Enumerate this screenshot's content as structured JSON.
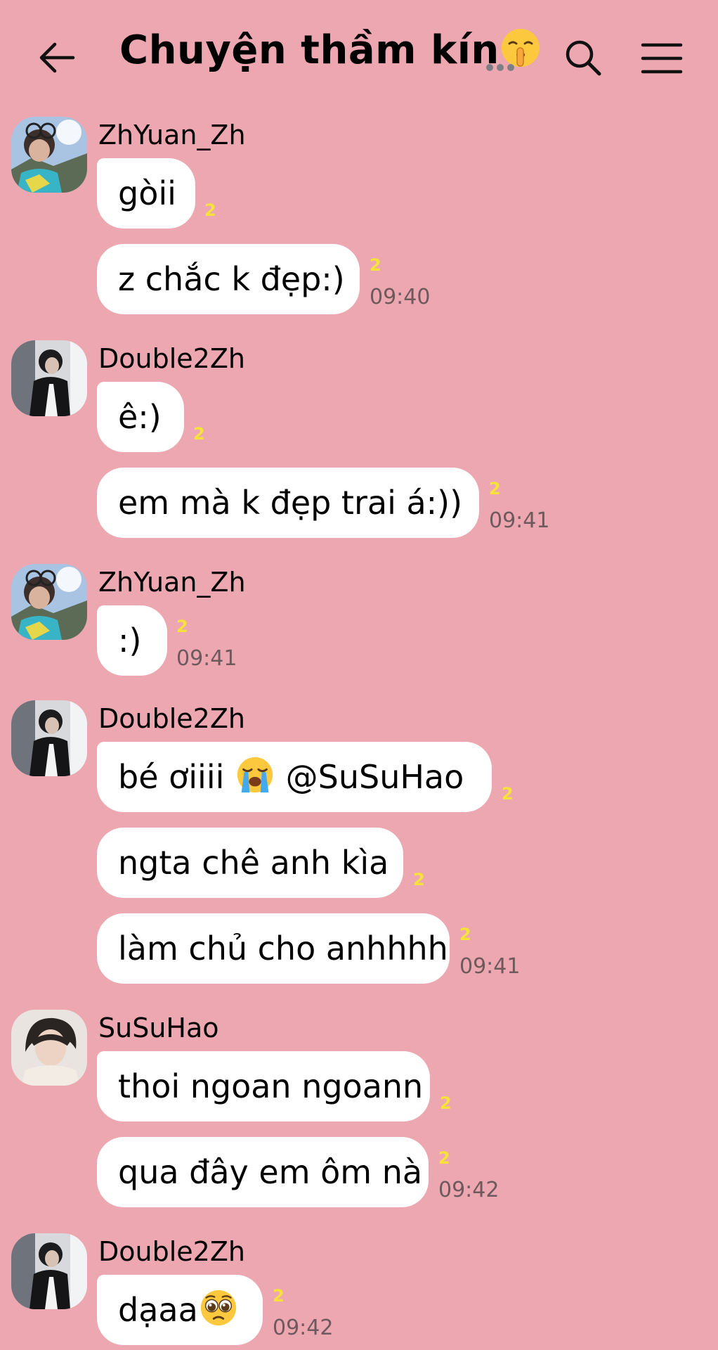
{
  "header": {
    "title": "Chuyện thầm kín",
    "title_emoji": "shushing-face",
    "more": "..."
  },
  "colors": {
    "background": "#eca7b0",
    "bubble": "#ffffff",
    "read_count": "#f6e23a",
    "time": "#6e5a5d"
  },
  "groups": [
    {
      "sender": "ZhYuan_Zh",
      "messages": [
        {
          "text": "gòii",
          "count": "2",
          "time": ""
        },
        {
          "text": "z chắc k đẹp:)",
          "count": "2",
          "time": "09:40"
        }
      ]
    },
    {
      "sender": "Double2Zh",
      "messages": [
        {
          "text": "ê:)",
          "count": "2",
          "time": ""
        },
        {
          "text": "em mà k đẹp trai á:))",
          "count": "2",
          "time": "09:41"
        }
      ]
    },
    {
      "sender": "ZhYuan_Zh",
      "messages": [
        {
          "text": ":)",
          "count": "2",
          "time": "09:41"
        }
      ]
    },
    {
      "sender": "Double2Zh",
      "messages": [
        {
          "text_before": "bé ơiiii ",
          "text_after": " @SuSuHao",
          "emoji": "loudly-crying-face",
          "count": "2",
          "time": ""
        },
        {
          "text": "ngta chê anh kìa",
          "count": "2",
          "time": ""
        },
        {
          "text": "làm chủ cho anhhhh",
          "count": "2",
          "time": "09:41"
        }
      ]
    },
    {
      "sender": "SuSuHao",
      "messages": [
        {
          "text": "thoi ngoan ngoann",
          "count": "2",
          "time": ""
        },
        {
          "text": "qua đây em ôm nà",
          "count": "2",
          "time": "09:42"
        }
      ]
    },
    {
      "sender": "Double2Zh",
      "messages": [
        {
          "text": "dạaa",
          "emoji": "pleading-face",
          "count": "2",
          "time": "09:42"
        }
      ]
    }
  ]
}
